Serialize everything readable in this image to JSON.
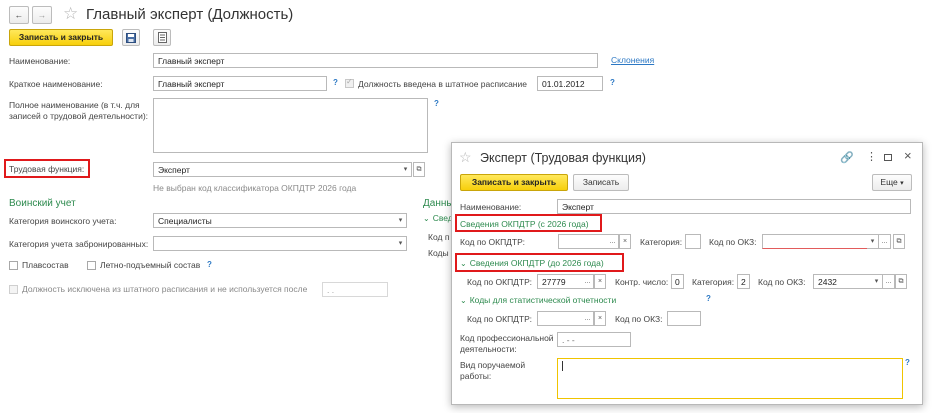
{
  "main": {
    "title": "Главный эксперт (Должность)",
    "toolbar": {
      "save_close": "Записать и закрыть"
    },
    "name_label": "Наименование:",
    "name_value": "Главный эксперт",
    "declension_link": "Склонения",
    "short_name_label": "Краткое наименование:",
    "short_name_value": "Главный эксперт",
    "staff_checkbox_label": "Должность введена в штатное расписание",
    "staff_date": "01.01.2012",
    "full_name_label_1": "Полное наименование (в т.ч. для",
    "full_name_label_2": "записей о трудовой деятельности):",
    "labor_function_label": "Трудовая функция:",
    "labor_function_value": "Эксперт",
    "okpdtr_warning": "Не выбран код классификатора ОКПДТР 2026 года",
    "military_section": "Воинский учет",
    "military_category_label": "Категория воинского учета:",
    "military_category_value": "Специалисты",
    "reserved_category_label": "Категория учета забронированных:",
    "reserved_category_value": "",
    "swimming_label": "Плавсостав",
    "flight_label": "Летно-подъемный состав",
    "excluded_label": "Должность исключена из штатного расписания и не используется после",
    "excluded_date": " .  .",
    "partial_section": "Данны",
    "partial_sub": "Сведе",
    "partial_code": "Код п",
    "partial_codes": "Коды"
  },
  "dialog": {
    "title": "Эксперт (Трудовая функция)",
    "save_close": "Записать и закрыть",
    "save": "Записать",
    "more": "Еще",
    "name_label": "Наименование:",
    "name_value": "Эксперт",
    "section_2026": "Сведения ОКПДТР (с 2026 года)",
    "okpdtr_label": "Код по ОКПДТР:",
    "okpdtr_value": "",
    "category_label": "Категория:",
    "okz_label": "Код по ОКЗ:",
    "section_pre2026": "Сведения ОКПДТР (до 2026 года)",
    "okpdtr_old_label": "Код по ОКПДТР:",
    "okpdtr_old_value": "27779",
    "control_label": "Контр. число:",
    "control_value": "0",
    "category_old_label": "Категория:",
    "category_old_value": "2",
    "okz_old_label": "Код по ОКЗ:",
    "okz_old_value": "2432",
    "stat_section": "Коды для статистической отчетности",
    "stat_okpdtr_label": "Код по ОКПДТР:",
    "stat_okz_label": "Код по ОКЗ:",
    "prof_label_1": "Код профессиональной",
    "prof_label_2": "деятельности:",
    "prof_value": " .  - -",
    "work_label_1": "Вид поручаемой",
    "work_label_2": "работы:"
  },
  "icons": {
    "back": "arrow-left-icon",
    "forward": "arrow-right-icon",
    "star": "star-icon",
    "save": "floppy-disk-icon",
    "report": "document-list-icon",
    "link": "link-icon",
    "menu": "kebab-menu-icon",
    "maximize": "maximize-icon",
    "close": "close-icon"
  },
  "colors": {
    "accent_yellow": "#f7cf0b",
    "highlight_red": "#e0191b",
    "section_green": "#2d8a4e",
    "link_blue": "#2c78c4",
    "active_input_border": "#f0c400"
  }
}
